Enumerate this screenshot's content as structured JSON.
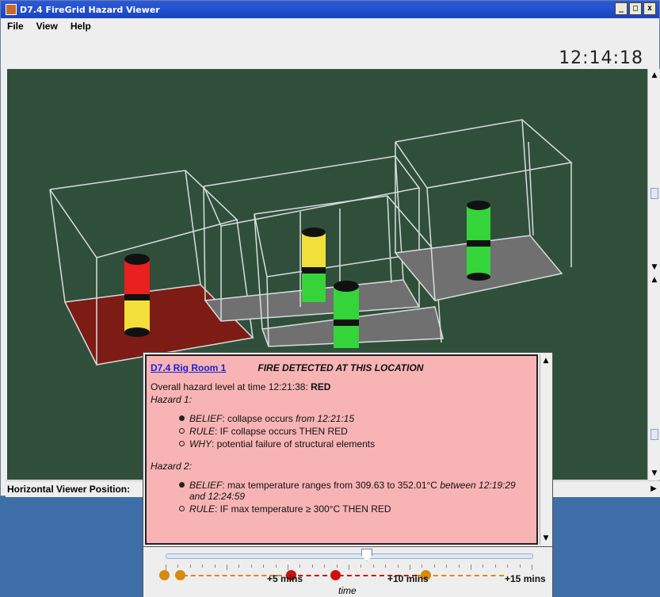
{
  "window": {
    "title": "D7.4 FireGrid Hazard Viewer",
    "buttons": {
      "minimize": "_",
      "maximize": "□",
      "close": "x"
    }
  },
  "menu": {
    "items": [
      "File",
      "View",
      "Help"
    ]
  },
  "clock": "12:14:18",
  "viewer": {
    "horizontal_position_label": "Horizontal Viewer Position:",
    "background_color": "#304f3a",
    "status_colors": {
      "red": "#e8201f",
      "yellow": "#f2df3a",
      "green": "#35d43a",
      "fire_floor": "#7c1c14"
    }
  },
  "info_panel": {
    "room_link": "D7.4 Rig Room 1",
    "alert": "FIRE DETECTED AT THIS LOCATION",
    "overall_prefix": "Overall hazard level at time 12:21:38: ",
    "overall_level": "RED",
    "hazards": [
      {
        "title": "Hazard 1:",
        "items": [
          {
            "bullet": "filled",
            "key": "BELIEF",
            "text": ": collapse occurs ",
            "em": "from 12:21:15",
            "tail": ""
          },
          {
            "bullet": "open",
            "key": "RULE",
            "text": ": IF collapse occurs THEN RED",
            "em": "",
            "tail": ""
          },
          {
            "bullet": "open",
            "key": "WHY",
            "text": ": potential failure of structural elements",
            "em": "",
            "tail": ""
          }
        ]
      },
      {
        "title": "Hazard 2:",
        "items": [
          {
            "bullet": "filled",
            "key": "BELIEF",
            "text": ": max temperature ranges from 309.63 to 352.01°C ",
            "em": "between 12:19:29 and 12:24:59",
            "tail": ""
          },
          {
            "bullet": "open",
            "key": "RULE",
            "text": ": IF max temperature ≥ 300°C THEN RED",
            "em": "",
            "tail": ""
          }
        ]
      }
    ]
  },
  "timeline": {
    "slider_fraction": 0.55,
    "labels": {
      "plus5": "+5 mins",
      "plus10": "+10 mins",
      "plus15": "+15 mins"
    },
    "axis_label": "time",
    "colors": {
      "orange": "#d68b0f",
      "red": "#cc1111"
    }
  }
}
